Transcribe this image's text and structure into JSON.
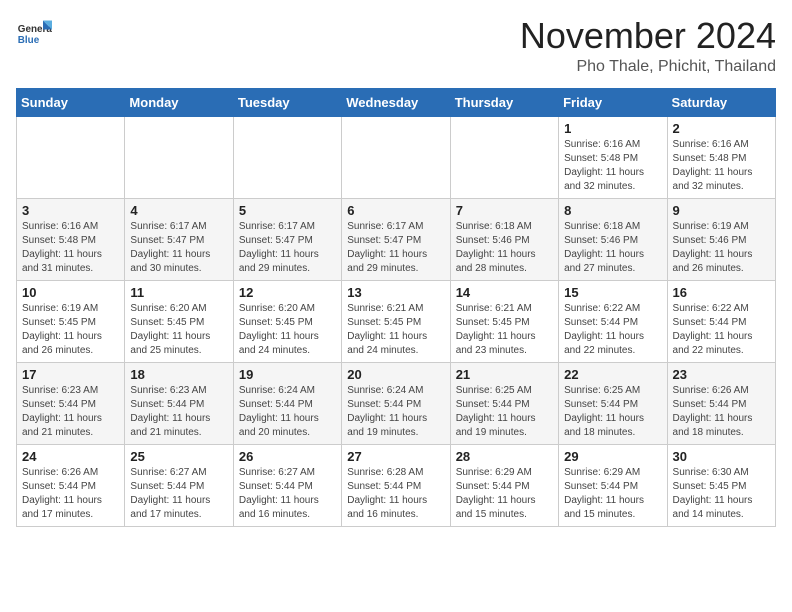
{
  "logo": {
    "general": "General",
    "blue": "Blue"
  },
  "header": {
    "month": "November 2024",
    "location": "Pho Thale, Phichit, Thailand"
  },
  "weekdays": [
    "Sunday",
    "Monday",
    "Tuesday",
    "Wednesday",
    "Thursday",
    "Friday",
    "Saturday"
  ],
  "weeks": [
    [
      {
        "day": "",
        "info": ""
      },
      {
        "day": "",
        "info": ""
      },
      {
        "day": "",
        "info": ""
      },
      {
        "day": "",
        "info": ""
      },
      {
        "day": "",
        "info": ""
      },
      {
        "day": "1",
        "info": "Sunrise: 6:16 AM\nSunset: 5:48 PM\nDaylight: 11 hours and 32 minutes."
      },
      {
        "day": "2",
        "info": "Sunrise: 6:16 AM\nSunset: 5:48 PM\nDaylight: 11 hours and 32 minutes."
      }
    ],
    [
      {
        "day": "3",
        "info": "Sunrise: 6:16 AM\nSunset: 5:48 PM\nDaylight: 11 hours and 31 minutes."
      },
      {
        "day": "4",
        "info": "Sunrise: 6:17 AM\nSunset: 5:47 PM\nDaylight: 11 hours and 30 minutes."
      },
      {
        "day": "5",
        "info": "Sunrise: 6:17 AM\nSunset: 5:47 PM\nDaylight: 11 hours and 29 minutes."
      },
      {
        "day": "6",
        "info": "Sunrise: 6:17 AM\nSunset: 5:47 PM\nDaylight: 11 hours and 29 minutes."
      },
      {
        "day": "7",
        "info": "Sunrise: 6:18 AM\nSunset: 5:46 PM\nDaylight: 11 hours and 28 minutes."
      },
      {
        "day": "8",
        "info": "Sunrise: 6:18 AM\nSunset: 5:46 PM\nDaylight: 11 hours and 27 minutes."
      },
      {
        "day": "9",
        "info": "Sunrise: 6:19 AM\nSunset: 5:46 PM\nDaylight: 11 hours and 26 minutes."
      }
    ],
    [
      {
        "day": "10",
        "info": "Sunrise: 6:19 AM\nSunset: 5:45 PM\nDaylight: 11 hours and 26 minutes."
      },
      {
        "day": "11",
        "info": "Sunrise: 6:20 AM\nSunset: 5:45 PM\nDaylight: 11 hours and 25 minutes."
      },
      {
        "day": "12",
        "info": "Sunrise: 6:20 AM\nSunset: 5:45 PM\nDaylight: 11 hours and 24 minutes."
      },
      {
        "day": "13",
        "info": "Sunrise: 6:21 AM\nSunset: 5:45 PM\nDaylight: 11 hours and 24 minutes."
      },
      {
        "day": "14",
        "info": "Sunrise: 6:21 AM\nSunset: 5:45 PM\nDaylight: 11 hours and 23 minutes."
      },
      {
        "day": "15",
        "info": "Sunrise: 6:22 AM\nSunset: 5:44 PM\nDaylight: 11 hours and 22 minutes."
      },
      {
        "day": "16",
        "info": "Sunrise: 6:22 AM\nSunset: 5:44 PM\nDaylight: 11 hours and 22 minutes."
      }
    ],
    [
      {
        "day": "17",
        "info": "Sunrise: 6:23 AM\nSunset: 5:44 PM\nDaylight: 11 hours and 21 minutes."
      },
      {
        "day": "18",
        "info": "Sunrise: 6:23 AM\nSunset: 5:44 PM\nDaylight: 11 hours and 21 minutes."
      },
      {
        "day": "19",
        "info": "Sunrise: 6:24 AM\nSunset: 5:44 PM\nDaylight: 11 hours and 20 minutes."
      },
      {
        "day": "20",
        "info": "Sunrise: 6:24 AM\nSunset: 5:44 PM\nDaylight: 11 hours and 19 minutes."
      },
      {
        "day": "21",
        "info": "Sunrise: 6:25 AM\nSunset: 5:44 PM\nDaylight: 11 hours and 19 minutes."
      },
      {
        "day": "22",
        "info": "Sunrise: 6:25 AM\nSunset: 5:44 PM\nDaylight: 11 hours and 18 minutes."
      },
      {
        "day": "23",
        "info": "Sunrise: 6:26 AM\nSunset: 5:44 PM\nDaylight: 11 hours and 18 minutes."
      }
    ],
    [
      {
        "day": "24",
        "info": "Sunrise: 6:26 AM\nSunset: 5:44 PM\nDaylight: 11 hours and 17 minutes."
      },
      {
        "day": "25",
        "info": "Sunrise: 6:27 AM\nSunset: 5:44 PM\nDaylight: 11 hours and 17 minutes."
      },
      {
        "day": "26",
        "info": "Sunrise: 6:27 AM\nSunset: 5:44 PM\nDaylight: 11 hours and 16 minutes."
      },
      {
        "day": "27",
        "info": "Sunrise: 6:28 AM\nSunset: 5:44 PM\nDaylight: 11 hours and 16 minutes."
      },
      {
        "day": "28",
        "info": "Sunrise: 6:29 AM\nSunset: 5:44 PM\nDaylight: 11 hours and 15 minutes."
      },
      {
        "day": "29",
        "info": "Sunrise: 6:29 AM\nSunset: 5:44 PM\nDaylight: 11 hours and 15 minutes."
      },
      {
        "day": "30",
        "info": "Sunrise: 6:30 AM\nSunset: 5:45 PM\nDaylight: 11 hours and 14 minutes."
      }
    ]
  ]
}
